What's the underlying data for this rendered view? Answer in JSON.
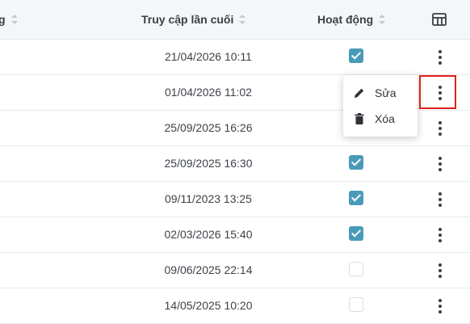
{
  "header": {
    "col_left_fragment": "g",
    "col_last_access": "Truy cập lần cuối",
    "col_active": "Hoạt động"
  },
  "rows": [
    {
      "last_access": "21/04/2026 10:11",
      "active": true
    },
    {
      "last_access": "01/04/2026 11:02",
      "active": true
    },
    {
      "last_access": "25/09/2025 16:26",
      "active": true
    },
    {
      "last_access": "25/09/2025 16:30",
      "active": true
    },
    {
      "last_access": "09/11/2023 13:25",
      "active": true
    },
    {
      "last_access": "02/03/2026 15:40",
      "active": true
    },
    {
      "last_access": "09/06/2025 22:14",
      "active": false
    },
    {
      "last_access": "14/05/2025 10:20",
      "active": false
    }
  ],
  "context_menu": {
    "edit_label": "Sửa",
    "delete_label": "Xóa"
  },
  "icons": {
    "column_settings": "table-columns-icon",
    "row_actions": "more-vertical-icon",
    "edit": "pencil-icon",
    "delete": "trash-icon"
  },
  "colors": {
    "checkbox_checked": "#4a9ab9",
    "highlight_box": "#e0201d",
    "header_bg": "#f5f6f8"
  }
}
